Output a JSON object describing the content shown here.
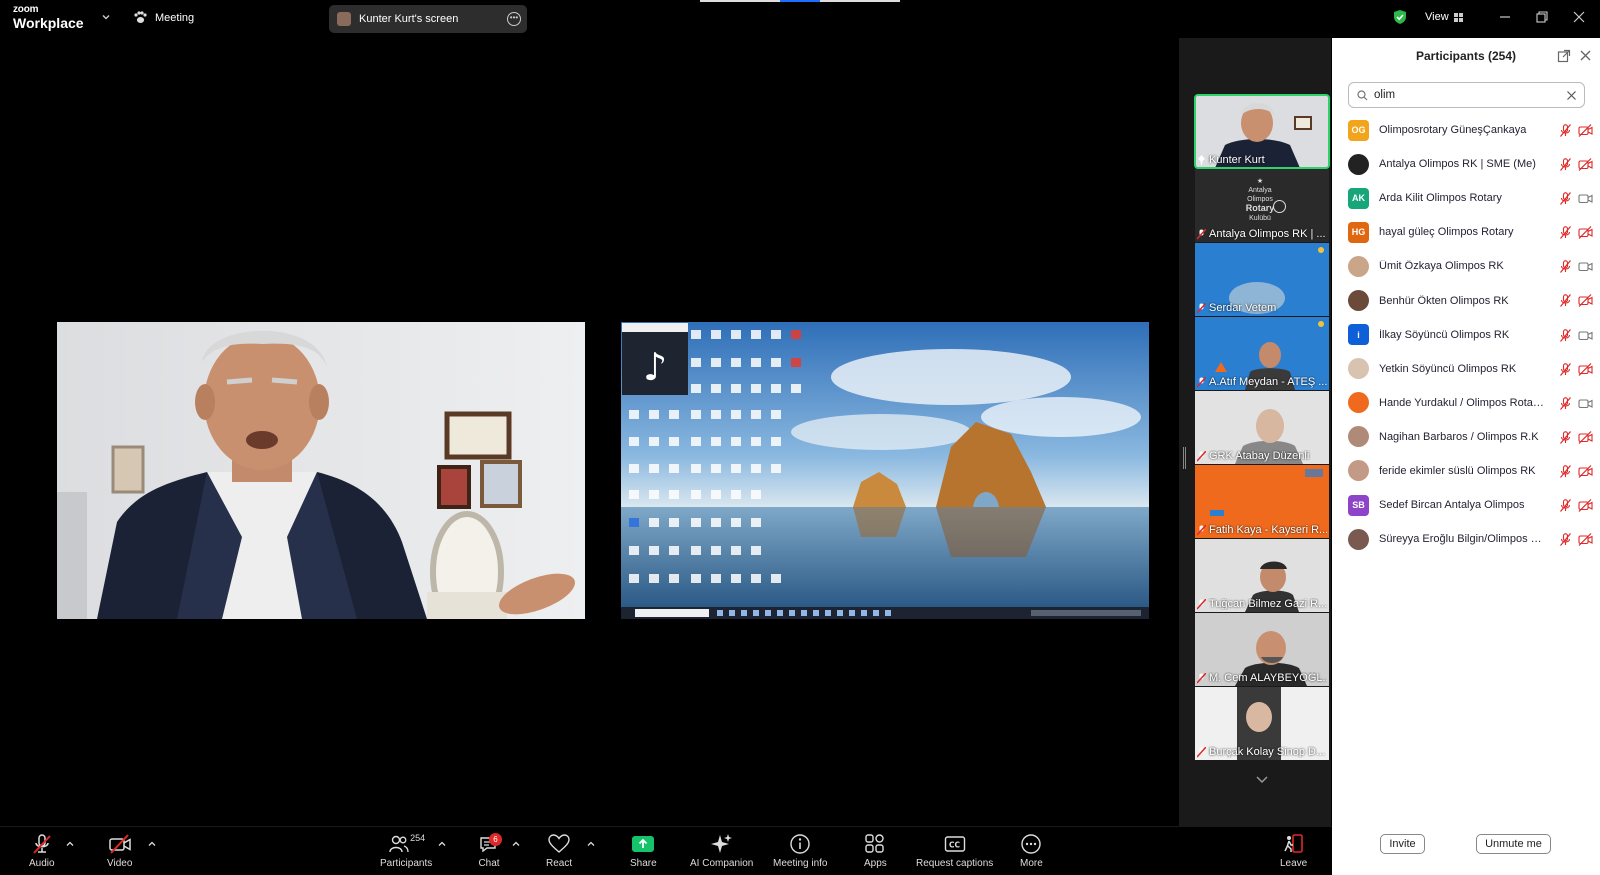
{
  "app": {
    "brand_top": "zoom",
    "brand_bottom": "Workplace",
    "meeting_label": "Meeting"
  },
  "top": {
    "screen_share_label": "Kunter Kurt's screen",
    "view_label": "View"
  },
  "gallery": {
    "tiles": [
      {
        "name": "Kunter Kurt",
        "active": true
      },
      {
        "name": "Antalya Olimpos RK | ..."
      },
      {
        "name": "Serdar Vetem"
      },
      {
        "name": "A.Atıf Meydan - ATEŞ ..."
      },
      {
        "name": "GRK Atabay Düzenli"
      },
      {
        "name": "Fatih Kaya - Kayseri R..."
      },
      {
        "name": "Tuğcan Bilmez Gazi R..."
      },
      {
        "name": "M. Cem ALAYBEYOĞL..."
      },
      {
        "name": "Burçak Kolay Sinop D..."
      }
    ]
  },
  "participants": {
    "title": "Participants (254)",
    "search_value": "olim",
    "items": [
      {
        "initials": "OG",
        "color": "#f2a41a",
        "name": "Olimposrotary GüneşÇankaya",
        "video": "off"
      },
      {
        "initials": "",
        "color": "#222222",
        "name": "Antalya Olimpos RK | SME (Me)",
        "video": "off"
      },
      {
        "initials": "AK",
        "color": "#16a67a",
        "name": "Arda Kilit Olimpos Rotary",
        "video": "on"
      },
      {
        "initials": "HG",
        "color": "#e0660f",
        "name": "hayal güleç Olimpos Rotary",
        "video": "off"
      },
      {
        "initials": "",
        "color": "#c9a58a",
        "name": "Ümit Özkaya Olimpos RK",
        "video": "on"
      },
      {
        "initials": "",
        "color": "#6b4a3a",
        "name": "Benhür Ökten Olimpos RK",
        "video": "off"
      },
      {
        "initials": "i",
        "color": "#0e5fd8",
        "name": "İlkay Söyüncü Olimpos RK",
        "video": "on"
      },
      {
        "initials": "",
        "color": "#d8c2b0",
        "name": "Yetkin Söyüncü Olimpos RK",
        "video": "off"
      },
      {
        "initials": "",
        "color": "#f06a1e",
        "name": "Hande Yurdakul / Olimpos Rotar...",
        "video": "on"
      },
      {
        "initials": "",
        "color": "#b08a78",
        "name": "Nagihan Barbaros / Olimpos R.K",
        "video": "off"
      },
      {
        "initials": "",
        "color": "#c29a86",
        "name": "feride ekimler süslü Olimpos RK",
        "video": "off"
      },
      {
        "initials": "SB",
        "color": "#8e44c8",
        "name": "Sedef Bircan Antalya Olimpos",
        "video": "off"
      },
      {
        "initials": "",
        "color": "#7a5a50",
        "name": "Süreyya Eroğlu Bilgin/Olimpos RK",
        "video": "off"
      }
    ],
    "invite_label": "Invite",
    "unmute_label": "Unmute me"
  },
  "toolbar": {
    "audio": "Audio",
    "video": "Video",
    "participants": "Participants",
    "participants_count": "254",
    "chat": "Chat",
    "chat_badge": "6",
    "react": "React",
    "share": "Share",
    "ai": "AI Companion",
    "info": "Meeting info",
    "apps": "Apps",
    "captions": "Request captions",
    "more": "More",
    "leave": "Leave"
  }
}
